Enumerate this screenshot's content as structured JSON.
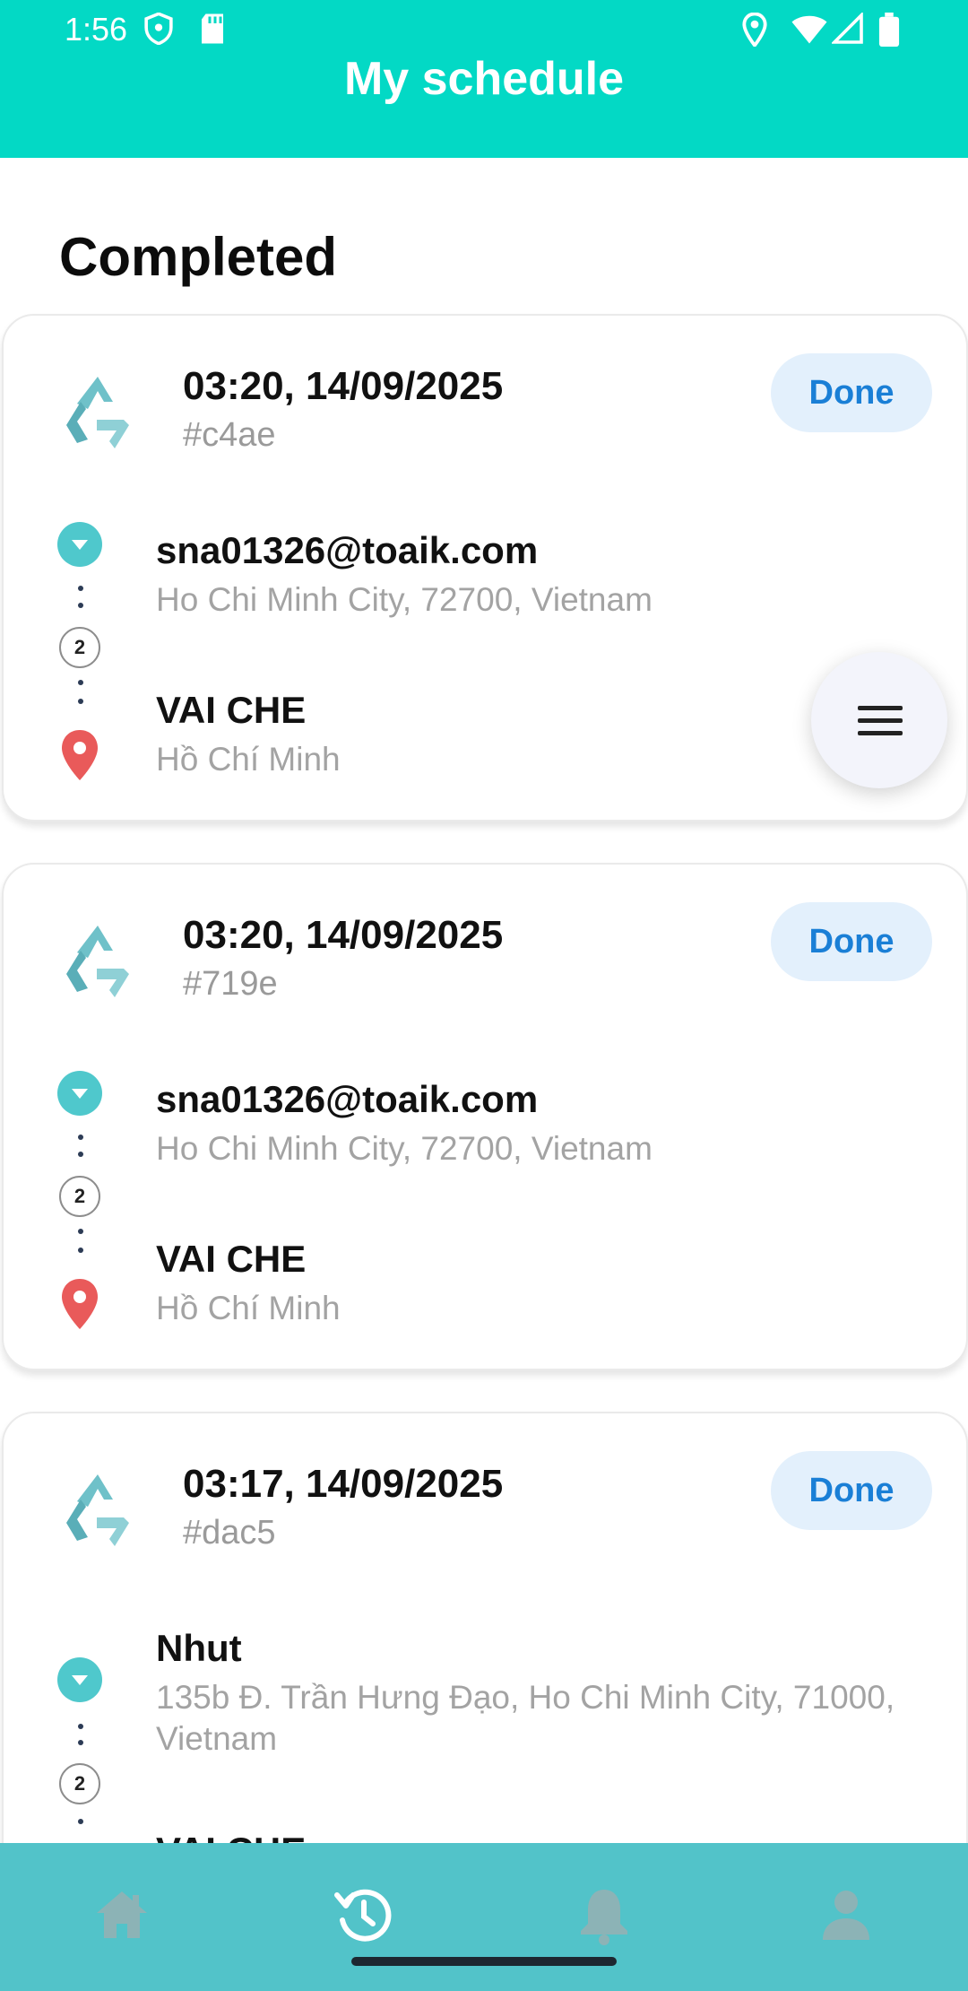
{
  "status_bar": {
    "time": "1:56"
  },
  "header": {
    "title": "My schedule"
  },
  "section": {
    "title": "Completed"
  },
  "colors": {
    "header": "#03d9c5",
    "bottom_nav": "#52c3c9",
    "pill_bg": "#e3f0fc",
    "pill_text": "#1a7fd6",
    "pin": "#e95a5a",
    "pickup": "#4fc8cc"
  },
  "orders": [
    {
      "datetime": "03:20, 14/09/2025",
      "code": "#c4ae",
      "status": "Done",
      "pickup": {
        "name": "sna01326@toaik.com",
        "address": "Ho Chi Minh City, 72700, Vietnam"
      },
      "count": "2",
      "dropoff": {
        "name": "VAI CHE",
        "address": "Hồ Chí Minh"
      }
    },
    {
      "datetime": "03:20, 14/09/2025",
      "code": "#719e",
      "status": "Done",
      "pickup": {
        "name": "sna01326@toaik.com",
        "address": "Ho Chi Minh City, 72700, Vietnam"
      },
      "count": "2",
      "dropoff": {
        "name": "VAI CHE",
        "address": "Hồ Chí Minh"
      }
    },
    {
      "datetime": "03:17, 14/09/2025",
      "code": "#dac5",
      "status": "Done",
      "pickup": {
        "name": "Nhut",
        "address": "135b Đ. Trần Hưng Đạo, Ho Chi Minh City, 71000, Vietnam"
      },
      "count": "2",
      "dropoff": {
        "name": "VAI CHE",
        "address": ""
      }
    }
  ],
  "fab": {
    "icon": "menu-icon"
  },
  "bottom_nav": {
    "items": [
      "home-icon",
      "history-icon",
      "bell-icon",
      "user-icon"
    ],
    "active": "history-icon"
  }
}
